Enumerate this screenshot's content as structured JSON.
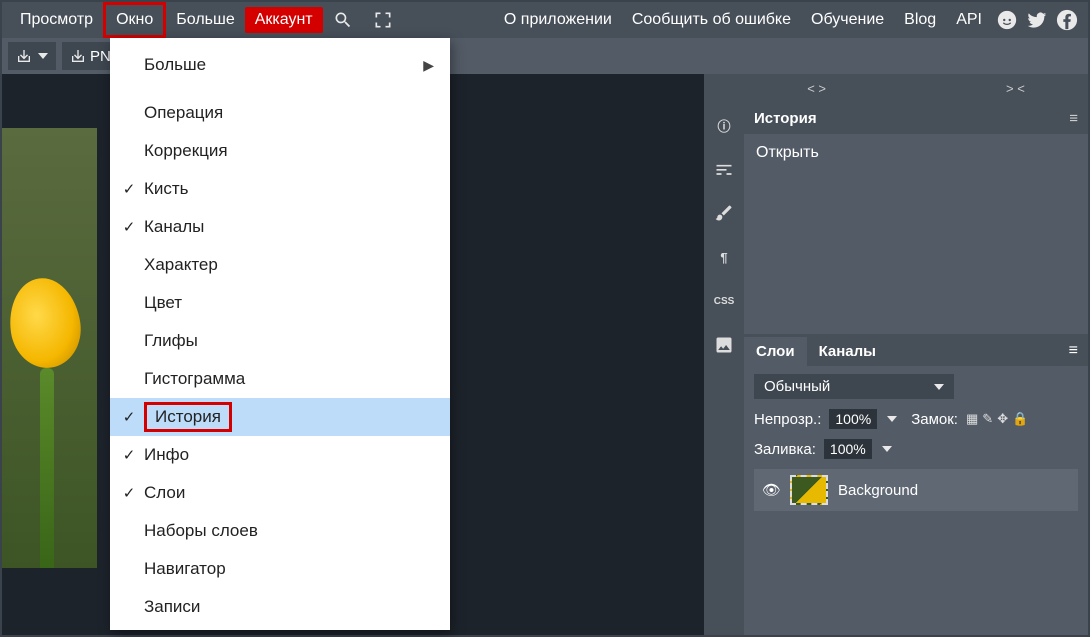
{
  "topbar": {
    "view": "Просмотр",
    "window": "Окно",
    "more": "Больше",
    "account": "Аккаунт",
    "about": "О приложении",
    "report": "Сообщить об ошибке",
    "learn": "Обучение",
    "blog": "Blog",
    "api": "API"
  },
  "subbar": {
    "png": "PNG"
  },
  "dropdown": {
    "more": "Больше",
    "operation": "Операция",
    "correction": "Коррекция",
    "brush": "Кисть",
    "channels": "Каналы",
    "character": "Характер",
    "color": "Цвет",
    "glyphs": "Глифы",
    "histogram": "Гистограмма",
    "history": "История",
    "info": "Инфо",
    "layers": "Слои",
    "layer_sets": "Наборы слоев",
    "navigator": "Навигатор",
    "notes": "Записи",
    "checked": {
      "brush": true,
      "channels": true,
      "history": true,
      "info": true,
      "layers": true
    }
  },
  "code_head": {
    "left": "< >",
    "right": "> <"
  },
  "history_panel": {
    "title": "История",
    "open": "Открыть"
  },
  "layers_panel": {
    "tab_layers": "Слои",
    "tab_channels": "Каналы",
    "blend_mode": "Обычный",
    "opacity_label": "Непрозр.:",
    "opacity_value": "100%",
    "lock_label": "Замок:",
    "fill_label": "Заливка:",
    "fill_value": "100%",
    "layer_name": "Background"
  },
  "right_rail": {
    "info": "ⓘ",
    "adjust": "≡",
    "brush": "✎",
    "paragraph": "¶",
    "css": "CSS",
    "image": "▣"
  }
}
